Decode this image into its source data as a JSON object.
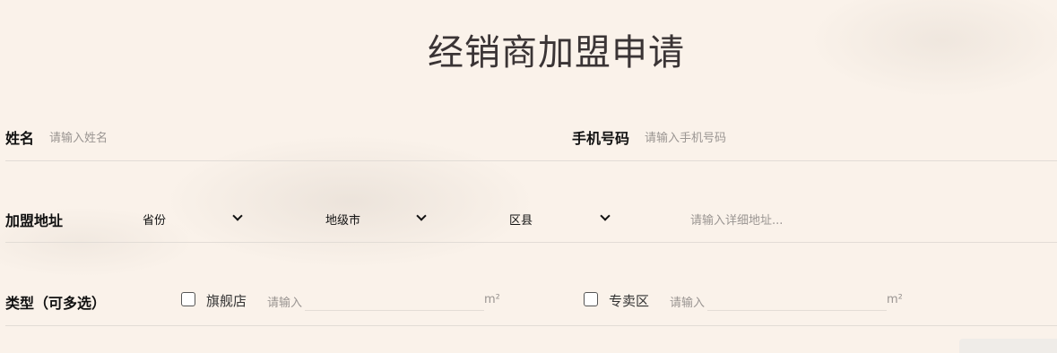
{
  "page_title": "经销商加盟申请",
  "name_field": {
    "label": "姓名",
    "placeholder": "请输入姓名"
  },
  "phone_field": {
    "label": "手机号码",
    "placeholder": "请输入手机号码"
  },
  "address": {
    "label": "加盟地址",
    "province": "省份",
    "city": "地级市",
    "district": "区县",
    "detail_placeholder": "请输入详细地址..."
  },
  "type": {
    "label": "类型（可多选）",
    "options": [
      {
        "label": "旗舰店",
        "placeholder": "请输入",
        "unit": "m²"
      },
      {
        "label": "专卖区",
        "placeholder": "请输入",
        "unit": "m²"
      }
    ]
  }
}
